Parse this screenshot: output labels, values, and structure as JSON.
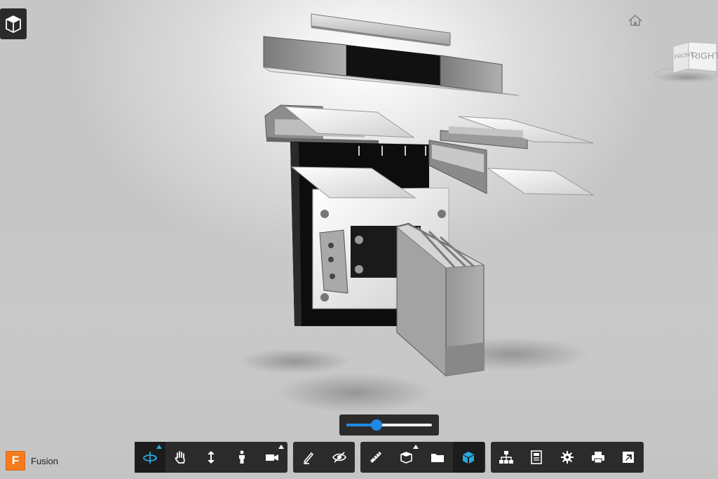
{
  "app": {
    "brand_letter": "F",
    "brand_name": "Fusion"
  },
  "viewcube": {
    "front_label": "FRONT",
    "right_label": "RIGHT"
  },
  "slider": {
    "value": 0.35
  },
  "toolbar": {
    "groups": [
      {
        "name": "navigation",
        "tools": [
          "orbit-icon",
          "pan-icon",
          "zoom-icon",
          "first-person-icon",
          "camera-icon"
        ]
      },
      {
        "name": "markup",
        "tools": [
          "markup-icon",
          "visibility-icon"
        ]
      },
      {
        "name": "analysis",
        "tools": [
          "measure-icon",
          "explode-icon",
          "model-browser-icon",
          "properties-cube-icon"
        ]
      },
      {
        "name": "view",
        "tools": [
          "structure-icon",
          "properties-icon",
          "settings-icon",
          "print-icon",
          "fullscreen-icon"
        ]
      }
    ]
  },
  "colors": {
    "accent": "#1e88e5",
    "brand": "#f47b20",
    "toolbar_bg": "#2b2b2b"
  }
}
